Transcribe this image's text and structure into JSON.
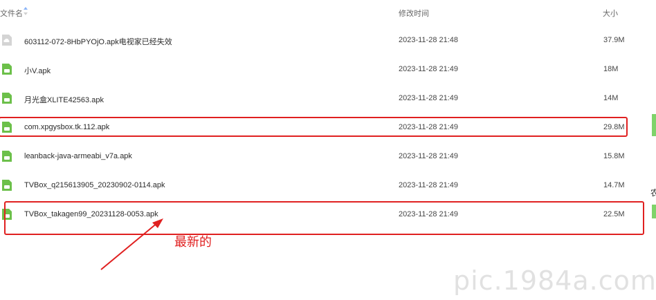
{
  "header": {
    "name_label": "文件名",
    "time_label": "修改时间",
    "size_label": "大小"
  },
  "files": [
    {
      "name": "603112-072-8HbPYOjO.apk电视家已经失效",
      "time": "2023-11-28 21:48",
      "size": "37.9M",
      "icon": "cloud-file-icon",
      "icon_color": "#c8c8c8"
    },
    {
      "name": "小V.apk",
      "time": "2023-11-28 21:49",
      "size": "18M",
      "icon": "apk-file-icon",
      "icon_color": "#6cc04a"
    },
    {
      "name": "月光盒XLITE42563.apk",
      "time": "2023-11-28 21:49",
      "size": "14M",
      "icon": "apk-file-icon",
      "icon_color": "#6cc04a"
    },
    {
      "name": "com.xpgysbox.tk.112.apk",
      "time": "2023-11-28 21:49",
      "size": "29.8M",
      "icon": "apk-file-icon",
      "icon_color": "#6cc04a"
    },
    {
      "name": "leanback-java-armeabi_v7a.apk",
      "time": "2023-11-28 21:49",
      "size": "15.8M",
      "icon": "apk-file-icon",
      "icon_color": "#6cc04a"
    },
    {
      "name": "TVBox_q215613905_20230902-0114.apk",
      "time": "2023-11-28 21:49",
      "size": "14.7M",
      "icon": "apk-file-icon",
      "icon_color": "#6cc04a"
    },
    {
      "name": "TVBox_takagen99_20231128-0053.apk",
      "time": "2023-11-28 21:49",
      "size": "22.5M",
      "icon": "apk-file-icon",
      "icon_color": "#6cc04a"
    }
  ],
  "annotation": {
    "text": "最新的",
    "color": "#e02020"
  },
  "edge_text": "农",
  "watermark": "pic.1984a.com"
}
